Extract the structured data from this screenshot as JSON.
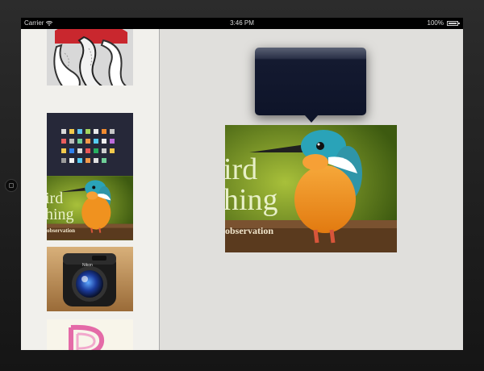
{
  "status_bar": {
    "carrier": "Carrier",
    "time": "3:46 PM",
    "battery": "100%"
  },
  "sidebar": {
    "thumbnails": [
      {
        "name": "lettering-artwork"
      },
      {
        "name": "icon-set-dark"
      },
      {
        "name": "bird-watching-kingfisher",
        "text_line1": "ird",
        "text_line2": "hing",
        "caption": "observation"
      },
      {
        "name": "camera-app-icon",
        "brand": "Nikon"
      },
      {
        "name": "pink-letter-artwork"
      }
    ]
  },
  "main_image": {
    "text_line1": "ird",
    "text_line2": "hing",
    "caption": "observation"
  },
  "colors": {
    "sidebar_bg": "#f1f0ec",
    "main_bg": "#e0dfdc",
    "popover_bg": "#0e1429"
  }
}
